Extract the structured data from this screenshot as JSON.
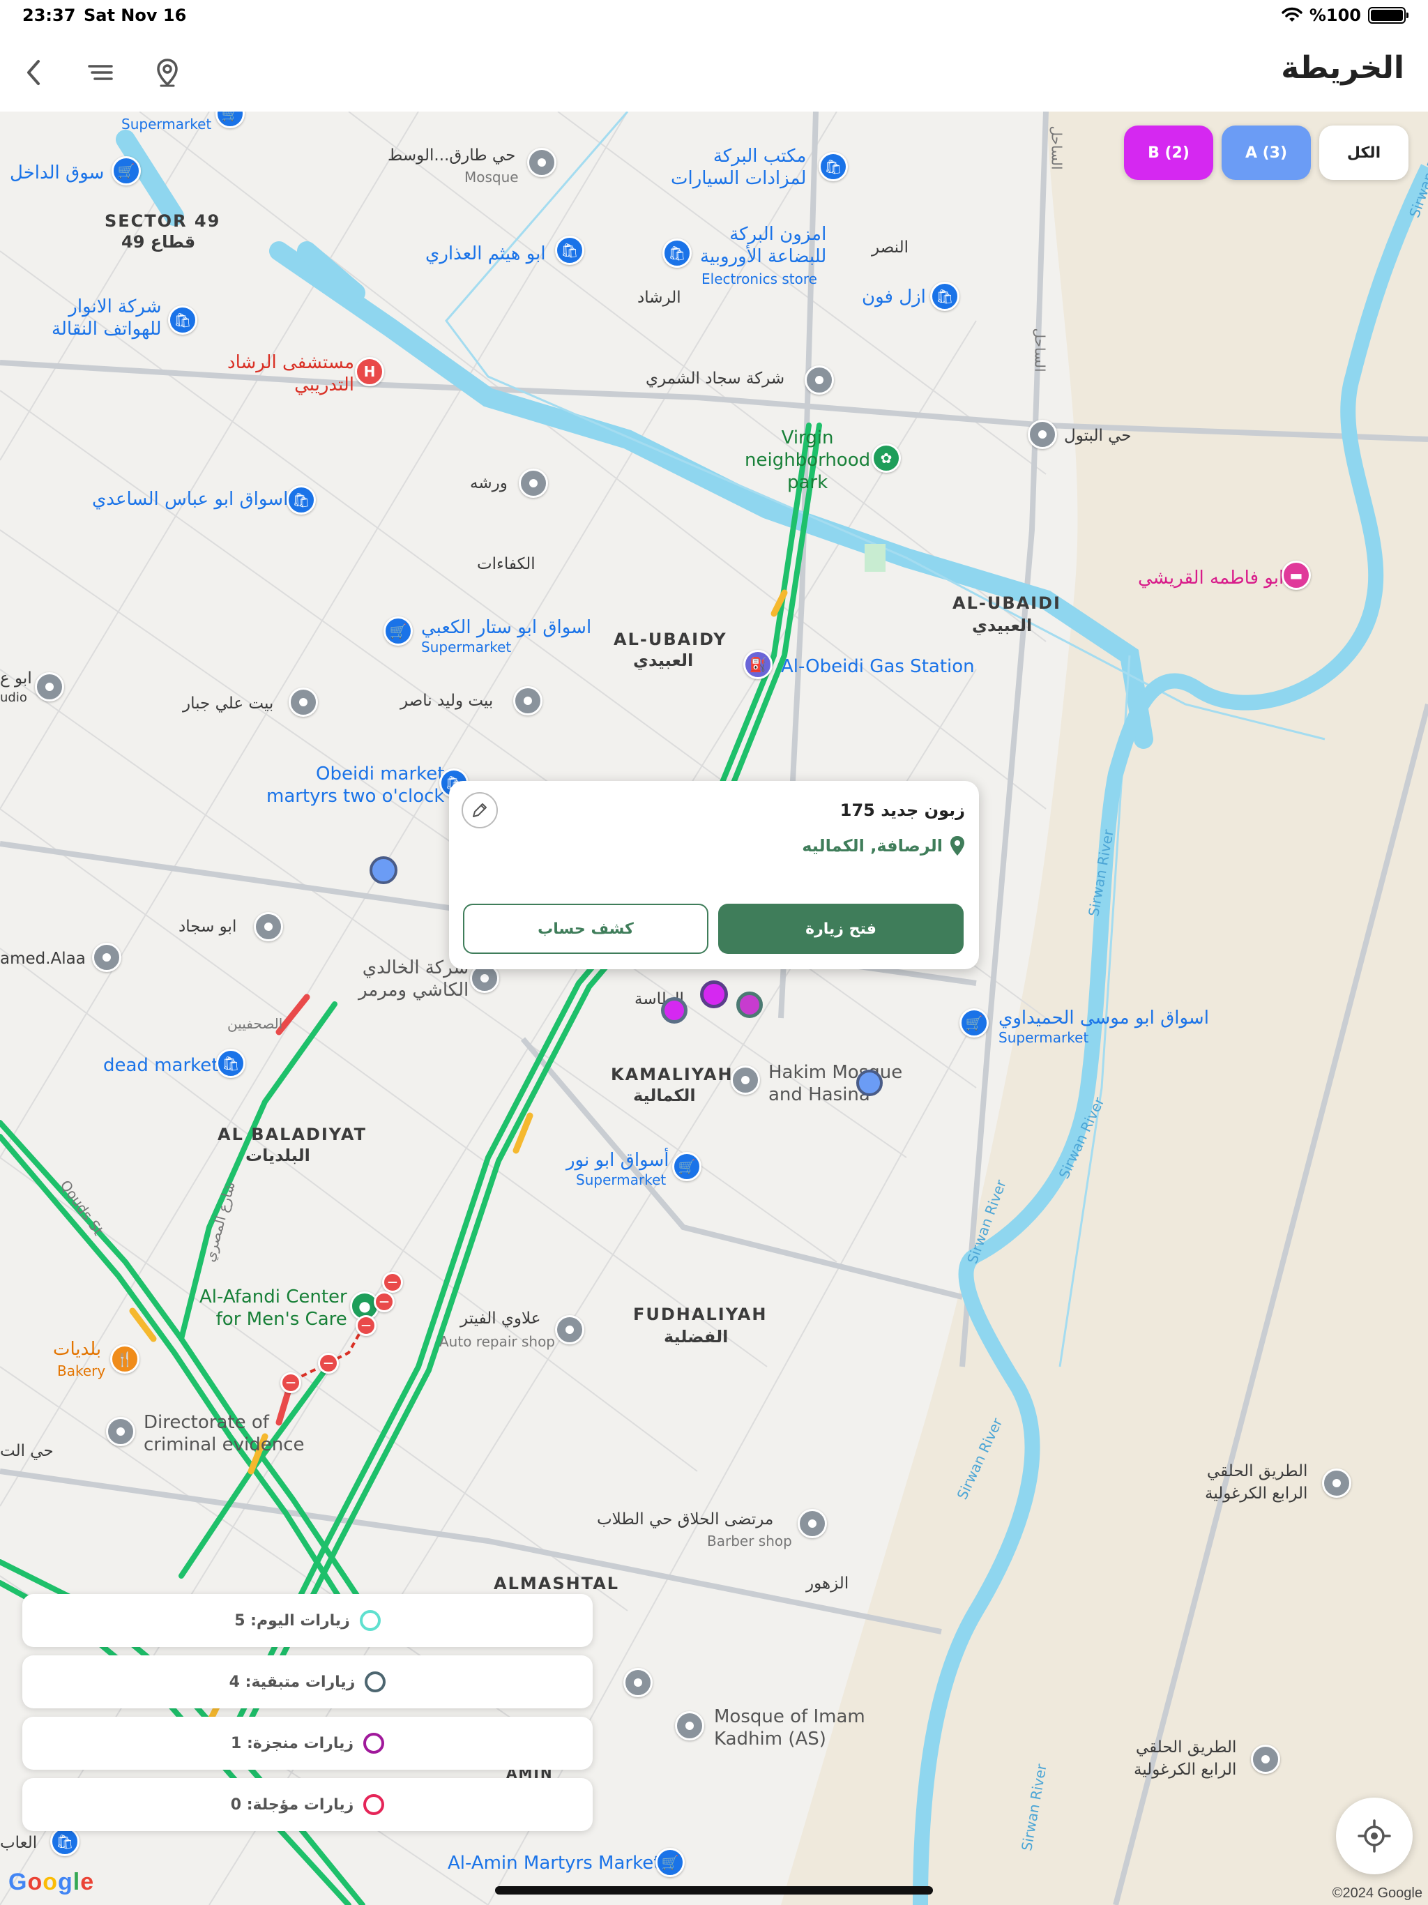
{
  "status_bar": {
    "time": "23:37",
    "date": "Sat Nov 16",
    "battery": "%100"
  },
  "nav": {
    "title": "الخريطة"
  },
  "filters": [
    {
      "label": "الكل",
      "color": "#ffffff"
    },
    {
      "label": "A (3)",
      "color": "#6b9cf5"
    },
    {
      "label": "B (2)",
      "color": "#d528f1"
    }
  ],
  "popup": {
    "title": "زبون جديد 175",
    "location": "الرصافة, الكماليه",
    "primary_button": "فتح زيارة",
    "secondary_button": "كشف حساب",
    "accent": "#3f7d5a"
  },
  "stats": [
    {
      "label": "زيارات اليوم: 5",
      "ring_color": "#5fe0cf"
    },
    {
      "label": "زيارات متبقية: 4",
      "ring_color": "#4d6670"
    },
    {
      "label": "زيارات منجزة: 1",
      "ring_color": "#a0199b"
    },
    {
      "label": "زيارات مؤجلة: 0",
      "ring_color": "#e52558"
    }
  ],
  "map_labels": {
    "supermarket": "Supermarket",
    "souq_dakhil": "سوق الداخل",
    "sector49_en": "SECTOR 49",
    "sector49_ar": "قطاع 49",
    "hay_tariq": "حي طارق...الوسط",
    "mosque": "Mosque",
    "maktab_baraka": "مكتب البركة\nلمزادات السيارات",
    "abu_haitham": "ابو هيثم العذاري",
    "mazoon_baraka": "امزون البركة\nللبضاعة الأوروبية",
    "electronics_store": "Electronics store",
    "nasr": "النصر",
    "rashad": "الرشاد",
    "azal_phone": "ازل فون",
    "anwar_phones": "شركة الانوار\nللهواتف النقالة",
    "rashad_hospital": "مستشفى الرشاد\nالتدريبي",
    "sajjad_shammari": "شركة سجاد الشمري",
    "sahil1": "الساحل",
    "sahil2": "الساحل",
    "hay_batool": "حي البتول",
    "virgin_park": "Virgin\nneighborhood\npark",
    "warsha": "ورشه",
    "abu_abbas_market": "اسواق ابو عباس الساعدي",
    "kafaat": "الكفاءات",
    "al_ubaidi_en": "AL-UBAIDI",
    "al_ubaidi_ar": "العبيدي",
    "abu_fatima": "ابو فاطمه القريشي",
    "abu_sattar_market": "اسواق ابو ستار الكعبي",
    "al_ubaidy_en": "AL-UBAIDY",
    "al_ubaidy_ar": "العبيدي",
    "gas_station": "Al-Obeidi Gas Station",
    "abu_ali_left": "ابو ع",
    "audio": "udio",
    "beit_ali": "بيت علي جبار",
    "beit_walid": "بيت وليد ناصر",
    "obeidi_market": "Obeidi market\nmartyrs two o'clock",
    "abu_sajjad": "ابو سجاد",
    "ahmed_alaa": "amed.Alaa",
    "khalidi": "شركة الخالدي\nالكاشي ومرمر",
    "tahrasa": "الطاسة",
    "abu_musa_market": "اسواق ابو موسى الحميداوي",
    "sahafiyeen": "الصحفيين",
    "dead_market": "dead market",
    "kamaliyah_en": "KAMALIYAH",
    "kamaliyah_ar": "الكمالية",
    "hakim_mosque": "Hakim Mosque\nand Hasina",
    "baladiyat_en": "AL BALADIYAT",
    "baladiyat_ar": "البلديات",
    "abu_nour_market": "أسواق ابو نور",
    "qouds_st": "Qouds St",
    "masri_st": "شارع المصري",
    "afandi": "Al-Afandi Center\nfor Men's Care",
    "alawi_fitter": "علاوي الفيتر",
    "auto_repair": "Auto repair shop",
    "fudhaliyah_en": "FUDHALIYAH",
    "fudhaliyah_ar": "الفضلية",
    "baladiyat_bakery": "بلديات",
    "bakery": "Bakery",
    "criminal_evidence": "Directorate of\ncriminal evidence",
    "hay_left": "حي الت",
    "ring_road_1": "الطريق الحلقي\nالرابع الكرغولية",
    "murtada": "مرتضى الحلاق حي الطلاب",
    "barber": "Barber shop",
    "almashtal": "ALMASHTAL",
    "zuhoor": "الزهور",
    "mosque_kadhim": "Mosque of Imam\nKadhim (AS)",
    "ring_road_2": "الطريق الحلقي\nالرابع الكرغولية",
    "amin_martyrs": "Al-Amin Martyrs Market",
    "amin": "AMIN",
    "sirwan_river": "Sirwan River",
    "labadi": "العاب"
  },
  "google": "Google",
  "copyright": "©2024 Google"
}
